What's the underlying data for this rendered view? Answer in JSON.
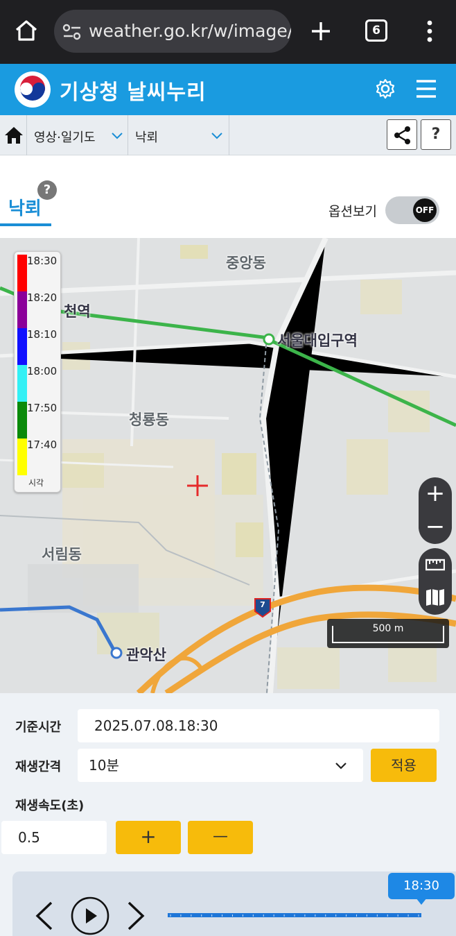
{
  "browser": {
    "url": "weather.go.kr/w/image/lg",
    "tab_count": "6",
    "icons": [
      "home-icon",
      "site-settings-icon",
      "new-tab-icon",
      "tab-switcher-icon",
      "more-menu-icon"
    ]
  },
  "site": {
    "title": "기상청 날씨누리",
    "logo": "kma-emblem",
    "icons": [
      "gear-icon",
      "hamburger-menu-icon"
    ],
    "brand_color": "#1a9be0"
  },
  "breadcrumb": {
    "category": "영상·일기도",
    "page": "낙뢰",
    "share_icon": "share-icon",
    "help_label": "?"
  },
  "tab": {
    "label": "낙뢰",
    "help_label": "?",
    "option_label": "옵션보기",
    "toggle_state": "OFF"
  },
  "map": {
    "places": [
      "중앙동",
      "청룡동",
      "서림동"
    ],
    "stations": [
      "천역",
      "서울대입구역",
      "관악산"
    ],
    "route_badge": "7",
    "scale": "500 m",
    "legend": {
      "ticks": [
        "18:30",
        "18:20",
        "18:10",
        "18:00",
        "17:50",
        "17:40"
      ],
      "colors": [
        "#ff0000",
        "#8b0099",
        "#1010ff",
        "#33f0f5",
        "#0a8a0a",
        "#ffff00"
      ],
      "caption": "시각"
    },
    "controls": [
      "zoom-in-icon",
      "zoom-out-icon",
      "ruler-icon",
      "map-layers-icon"
    ]
  },
  "controls": {
    "base_time_label": "기준시간",
    "base_time_value": "2025.07.08.18:30",
    "interval_label": "재생간격",
    "interval_value": "10분",
    "apply_label": "적용",
    "speed_label": "재생속도(초)",
    "speed_value": "0.5",
    "plus_label": "+",
    "minus_label": "—",
    "accent_color": "#f7bb0b"
  },
  "player": {
    "current_time": "18:30",
    "progress": 1.0
  }
}
